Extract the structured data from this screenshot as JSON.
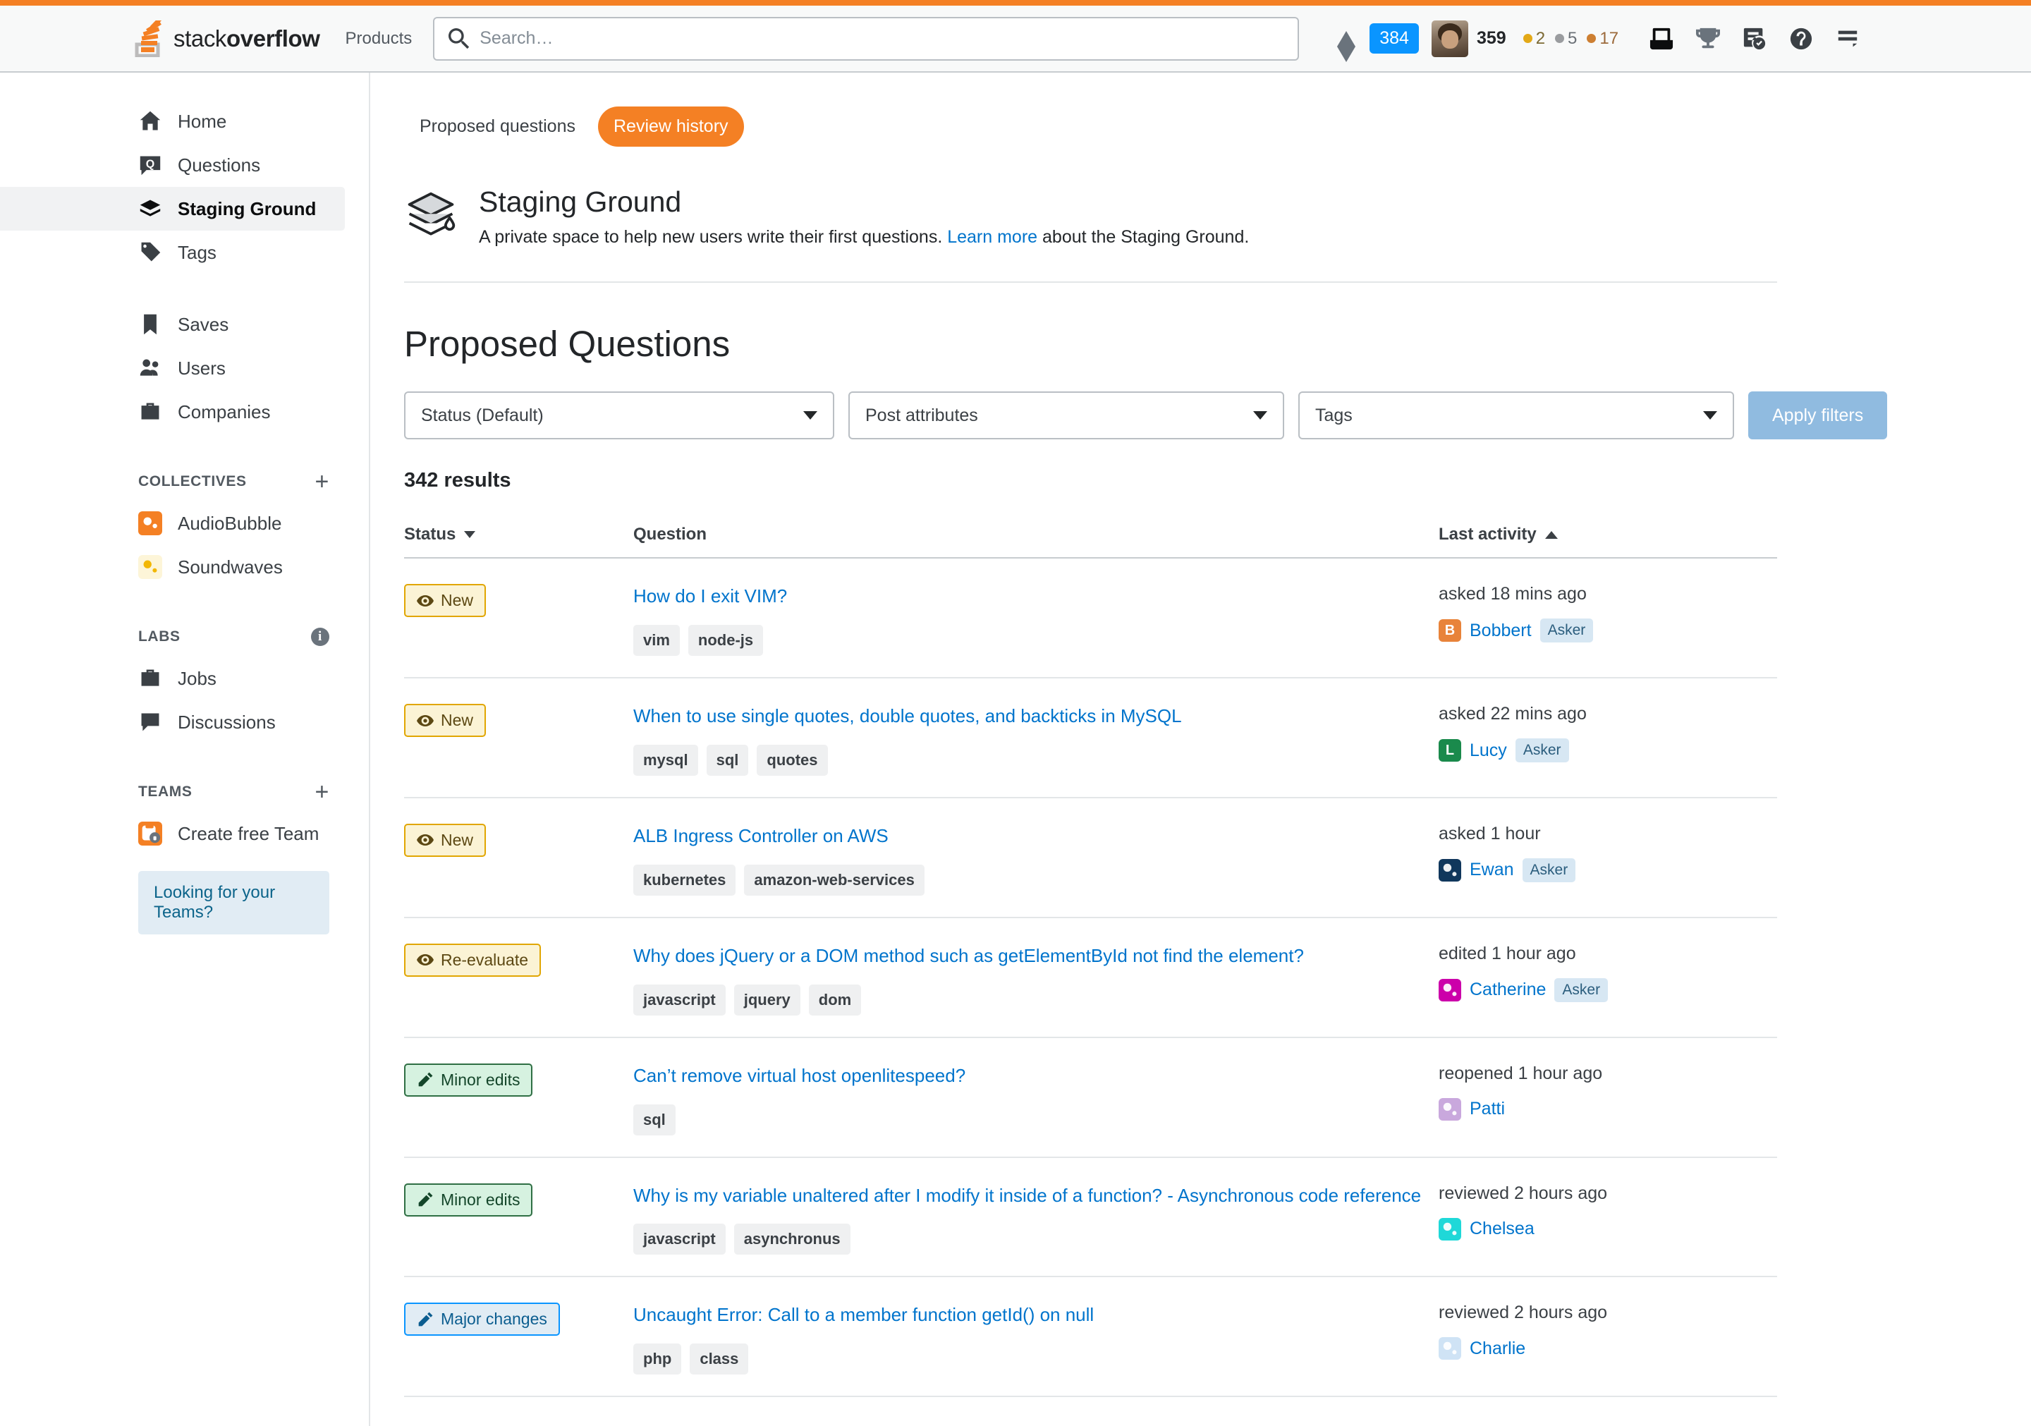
{
  "header": {
    "logo_text_light": "stack",
    "logo_text_bold": "overflow",
    "products_label": "Products",
    "search_placeholder": "Search…",
    "search_value": "",
    "inbox_badge": "384",
    "reputation": "359",
    "badges": {
      "gold": "2",
      "silver": "5",
      "bronze": "17"
    },
    "icons": {
      "diamond": "diamond-icon",
      "inbox": "inbox-icon",
      "achievements": "trophy-icon",
      "review": "review-queue-icon",
      "help": "help-icon",
      "menu": "hamburger-icon"
    }
  },
  "sidebar": {
    "primary": [
      {
        "label": "Home",
        "icon": "home-icon",
        "active": false
      },
      {
        "label": "Questions",
        "icon": "questions-icon",
        "active": false
      },
      {
        "label": "Staging Ground",
        "icon": "staging-ground-icon",
        "active": true
      },
      {
        "label": "Tags",
        "icon": "tag-icon",
        "active": false
      }
    ],
    "secondary": [
      {
        "label": "Saves",
        "icon": "bookmark-icon"
      },
      {
        "label": "Users",
        "icon": "users-icon"
      },
      {
        "label": "Companies",
        "icon": "briefcase-icon"
      }
    ],
    "collectives": {
      "title": "COLLECTIVES",
      "action": "add-collective-icon",
      "items": [
        {
          "label": "AudioBubble",
          "color": "#f48024"
        },
        {
          "label": "Soundwaves",
          "color": "#fdf5d8"
        }
      ]
    },
    "labs": {
      "title": "LABS",
      "action": "info-icon",
      "items": [
        {
          "label": "Jobs",
          "icon": "briefcase-icon"
        },
        {
          "label": "Discussions",
          "icon": "discussions-icon"
        }
      ]
    },
    "teams": {
      "title": "TEAMS",
      "action": "add-team-icon",
      "items": [
        {
          "label": "Create free Team",
          "color": "#f48024"
        }
      ],
      "cta": "Looking for your Teams?"
    }
  },
  "main": {
    "tabs": [
      {
        "label": "Proposed questions",
        "active": false
      },
      {
        "label": "Review history",
        "active": true
      }
    ],
    "intro": {
      "title": "Staging Ground",
      "description_before": "A private space to help new users write their first questions. ",
      "link_text": "Learn more",
      "description_after": " about the Staging Ground."
    },
    "page_title": "Proposed Questions",
    "filters": {
      "status": "Status (Default)",
      "post_attributes": "Post attributes",
      "tags": "Tags",
      "apply_label": "Apply filters"
    },
    "results_count": "342 results",
    "columns": {
      "status": "Status",
      "question": "Question",
      "activity": "Last activity"
    },
    "rows": [
      {
        "status": {
          "label": "New",
          "kind": "new",
          "icon": "eye-icon"
        },
        "title": "How do I exit VIM?",
        "tags": [
          "vim",
          "node-js"
        ],
        "activity": "asked 18 mins ago",
        "user": {
          "name": "Bobbert",
          "initial": "B",
          "color": "#e8833a",
          "is_asker": true,
          "asker_label": "Asker"
        }
      },
      {
        "status": {
          "label": "New",
          "kind": "new",
          "icon": "eye-icon"
        },
        "title": "When to use single quotes, double quotes, and backticks in MySQL",
        "tags": [
          "mysql",
          "sql",
          "quotes"
        ],
        "activity": "asked 22 mins ago",
        "user": {
          "name": "Lucy",
          "initial": "L",
          "color": "#1a8a4c",
          "is_asker": true,
          "asker_label": "Asker"
        }
      },
      {
        "status": {
          "label": "New",
          "kind": "new",
          "icon": "eye-icon"
        },
        "title": "ALB Ingress Controller on AWS",
        "tags": [
          "kubernetes",
          "amazon-web-services"
        ],
        "activity": "asked 1 hour",
        "user": {
          "name": "Ewan",
          "initial": "",
          "color": "#10375c",
          "is_asker": true,
          "asker_label": "Asker"
        }
      },
      {
        "status": {
          "label": "Re-evaluate",
          "kind": "reevaluate",
          "icon": "eye-icon"
        },
        "title": "Why does jQuery or a DOM method such as getElementById not find the element?",
        "tags": [
          "javascript",
          "jquery",
          "dom"
        ],
        "activity": "edited 1 hour ago",
        "user": {
          "name": "Catherine",
          "initial": "",
          "color": "#cc00aa",
          "is_asker": true,
          "asker_label": "Asker"
        }
      },
      {
        "status": {
          "label": "Minor edits",
          "kind": "minor",
          "icon": "pencil-icon"
        },
        "title": "Can’t remove virtual host openlitespeed?",
        "tags": [
          "sql"
        ],
        "activity": "reopened 1 hour ago",
        "user": {
          "name": "Patti",
          "initial": "",
          "color": "#c9a8dd",
          "is_asker": false,
          "asker_label": ""
        }
      },
      {
        "status": {
          "label": "Minor edits",
          "kind": "minor",
          "icon": "pencil-icon"
        },
        "title": "Why is my variable unaltered after I modify it inside of a function? -   Asynchronous code reference",
        "tags": [
          "javascript",
          "asynchronus"
        ],
        "activity": "reviewed 2 hours ago",
        "user": {
          "name": "Chelsea",
          "initial": "",
          "color": "#1fd8d8",
          "is_asker": false,
          "asker_label": ""
        }
      },
      {
        "status": {
          "label": "Major changes",
          "kind": "major",
          "icon": "pencil-icon"
        },
        "title": "Uncaught Error: Call to a member function getId() on null",
        "tags": [
          "php",
          "class"
        ],
        "activity": "reviewed 2 hours ago",
        "user": {
          "name": "Charlie",
          "initial": "",
          "color": "#cfe3f5",
          "is_asker": false,
          "asker_label": ""
        }
      }
    ]
  }
}
